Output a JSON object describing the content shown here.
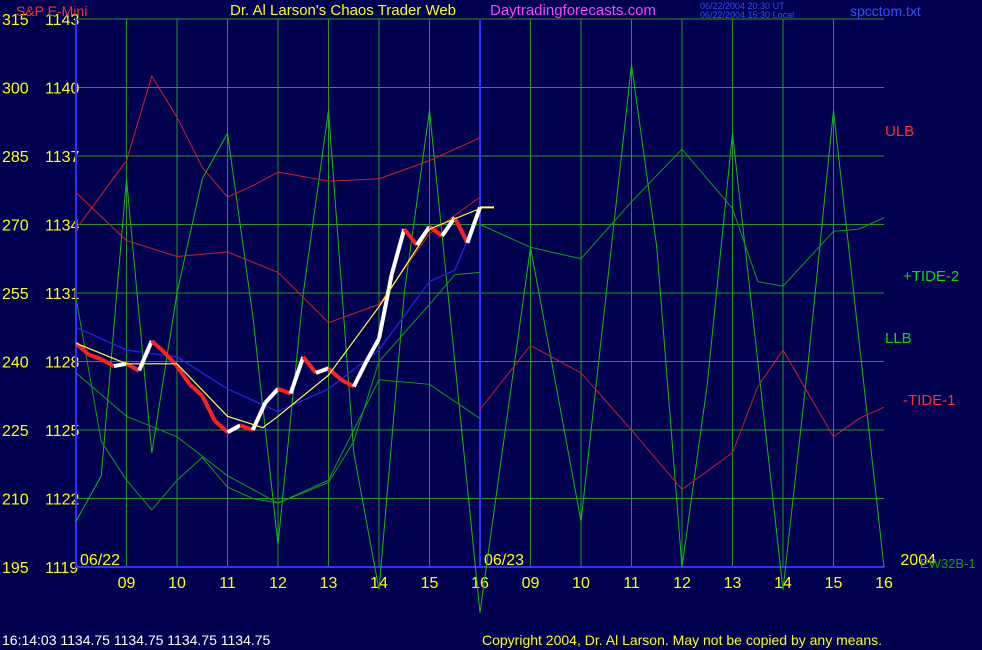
{
  "header": {
    "instrument": "S&P E-Mini",
    "site_title": "Dr. Al Larson's Chaos Trader Web",
    "site_url": "Daytradingforecasts.com",
    "time_ut": "06/22/2004 20:30 UT",
    "time_local": "06/22/2004 15:30 Local",
    "file_name": "spcctom.txt"
  },
  "footer": {
    "quote": "16:14:03  1134.75 1134.75 1134.75 1134.75",
    "copyright": "Copyright 2004, Dr. Al Larson. May not be copied by any means."
  },
  "colors": {
    "background": "#000050",
    "grid": "#1f9a1f",
    "axis": "#3030ff",
    "price_up": "#ffffff",
    "price_down": "#ff2020",
    "ulb": "#d02020",
    "llb": "#10a010",
    "tide1": "#c82020",
    "tide2": "#10a010",
    "fast_cycle": "#10c010",
    "moving_avg": "#ffff40",
    "slow_avg": "#2020d0",
    "text_yellow": "#ffff00",
    "text_green": "#00e000",
    "text_red": "#ff3030",
    "text_magenta": "#ff40ff",
    "text_blue": "#3050ff"
  },
  "chart_data": {
    "type": "line",
    "title": "S&P E-Mini",
    "y_labels_left": [
      "315",
      "300",
      "285",
      "270",
      "255",
      "240",
      "225",
      "210",
      "195"
    ],
    "y_labels_price": [
      "1143",
      "1140",
      "1137",
      "1134",
      "1131",
      "1128",
      "1125",
      "1122",
      "1119"
    ],
    "ylim_price": [
      1119,
      1143
    ],
    "ylim_index": [
      195,
      315
    ],
    "x_ticks": [
      "09",
      "10",
      "11",
      "12",
      "13",
      "14",
      "15",
      "16",
      "09",
      "10",
      "11",
      "12",
      "13",
      "14",
      "15",
      "16"
    ],
    "x_range_hours": [
      8.0,
      24.0
    ],
    "date_labels": [
      {
        "text": "06/22",
        "hour": 8.0
      },
      {
        "text": "06/23",
        "hour": 16.0
      },
      {
        "text": "2004",
        "hour": 24.0
      }
    ],
    "divider_hour": 16.0,
    "grid": true,
    "series_labels": {
      "ulb": "ULB",
      "tide2": "+TIDE-2",
      "llb": "LLB",
      "tide1": "-TIDE-1",
      "ew": "EW32B-1"
    },
    "price_bars": {
      "hours": [
        8.0,
        8.25,
        8.5,
        8.75,
        9.0,
        9.25,
        9.5,
        9.75,
        10.0,
        10.25,
        10.5,
        10.75,
        11.0,
        11.25,
        11.5,
        11.75,
        12.0,
        12.25,
        12.5,
        12.75,
        13.0,
        13.25,
        13.5,
        13.75,
        14.0,
        14.25,
        14.5,
        14.75,
        15.0,
        15.25,
        15.5,
        15.75,
        16.0
      ],
      "prices": [
        1128.8,
        1128.3,
        1128.1,
        1127.8,
        1127.9,
        1127.6,
        1128.9,
        1128.4,
        1127.8,
        1127.0,
        1126.5,
        1125.4,
        1124.9,
        1125.2,
        1125.0,
        1126.2,
        1126.8,
        1126.6,
        1128.2,
        1127.5,
        1127.7,
        1127.2,
        1126.9,
        1128.0,
        1129.0,
        1131.8,
        1133.8,
        1133.1,
        1133.9,
        1133.5,
        1134.3,
        1133.2,
        1134.75
      ]
    },
    "series": [
      {
        "key": "ulb",
        "hours": [
          8.0,
          9.0,
          9.5,
          10.0,
          10.5,
          11.0,
          11.5,
          12.0,
          13.0,
          14.0,
          15.0,
          16.0
        ],
        "values": [
          1133.8,
          1136.8,
          1140.5,
          1138.7,
          1136.5,
          1135.2,
          1135.7,
          1136.3,
          1135.9,
          1136.0,
          1136.8,
          1137.8
        ]
      },
      {
        "key": "upper2",
        "hours": [
          8.0,
          9.0,
          10.0,
          11.0,
          12.0,
          13.0,
          14.0,
          15.0,
          16.0
        ],
        "values": [
          1135.4,
          1133.3,
          1132.6,
          1132.8,
          1131.9,
          1129.7,
          1130.5,
          1133.6,
          1135.2
        ]
      },
      {
        "key": "llb",
        "hours": [
          8.0,
          8.5,
          9.0,
          9.5,
          10.0,
          10.5,
          11.0,
          11.5,
          12.0,
          13.0,
          13.5,
          14.0,
          15.0,
          15.5,
          16.0
        ],
        "values": [
          1130.8,
          1124.5,
          1122.8,
          1121.5,
          1122.8,
          1123.8,
          1122.5,
          1122.0,
          1121.8,
          1122.7,
          1124.5,
          1128.0,
          1130.5,
          1131.8,
          1131.9
        ]
      },
      {
        "key": "lower2",
        "hours": [
          8.0,
          9.0,
          10.0,
          11.0,
          12.0,
          12.5,
          13.0,
          14.0,
          15.0,
          16.0
        ],
        "values": [
          1127.5,
          1125.6,
          1124.7,
          1123.0,
          1121.8,
          1122.3,
          1122.8,
          1127.2,
          1127.0,
          1125.5
        ]
      },
      {
        "key": "tide1",
        "hours": [
          16.0,
          17.0,
          18.0,
          19.0,
          20.0,
          21.0,
          21.5,
          22.0,
          23.0,
          23.5,
          24.0
        ],
        "values": [
          1125.9,
          1128.7,
          1127.5,
          1125.0,
          1122.4,
          1124.0,
          1126.9,
          1128.5,
          1124.7,
          1125.5,
          1126.0
        ]
      },
      {
        "key": "tide2",
        "hours": [
          16.0,
          17.0,
          18.0,
          19.0,
          20.0,
          21.0,
          21.5,
          22.0,
          23.0,
          23.5,
          24.0
        ],
        "values": [
          1134.0,
          1133.0,
          1132.5,
          1135.0,
          1137.3,
          1134.7,
          1131.5,
          1131.3,
          1133.7,
          1133.8,
          1134.3
        ]
      },
      {
        "key": "fast_cycle",
        "hours": [
          8.0,
          8.5,
          9.0,
          9.5,
          10.0,
          10.5,
          11.0,
          11.5,
          12.0,
          12.5,
          13.0,
          13.5,
          14.0,
          14.5,
          15.0,
          15.5,
          16.0,
          16.5,
          17.0,
          17.5,
          18.0,
          18.5,
          19.0,
          19.5,
          20.0,
          20.5,
          21.0,
          21.5,
          22.0,
          22.5,
          23.0,
          23.5,
          24.0
        ],
        "values": [
          1121,
          1123,
          1136,
          1124,
          1131,
          1136,
          1138,
          1130,
          1120,
          1131,
          1139,
          1124,
          1118,
          1131,
          1139,
          1128,
          1117,
          1125,
          1133,
          1127,
          1121,
          1131,
          1141,
          1133,
          1119,
          1127,
          1138,
          1128,
          1118,
          1128,
          1139,
          1129,
          1119
        ]
      },
      {
        "key": "moving_avg",
        "hours": [
          8.0,
          9.0,
          10.0,
          11.0,
          11.7,
          12.0,
          13.0,
          14.0,
          15.0,
          16.0
        ],
        "values": [
          1128.8,
          1127.9,
          1127.9,
          1125.6,
          1125.1,
          1125.6,
          1127.4,
          1130.4,
          1133.8,
          1134.7
        ]
      },
      {
        "key": "slow_avg",
        "hours": [
          8.0,
          9.0,
          10.0,
          11.0,
          12.0,
          13.0,
          14.0,
          15.0,
          15.5,
          16.0
        ],
        "values": [
          1129.5,
          1128.5,
          1128.2,
          1126.8,
          1125.8,
          1126.8,
          1128.5,
          1131.5,
          1132.0,
          1134.6
        ]
      }
    ]
  }
}
